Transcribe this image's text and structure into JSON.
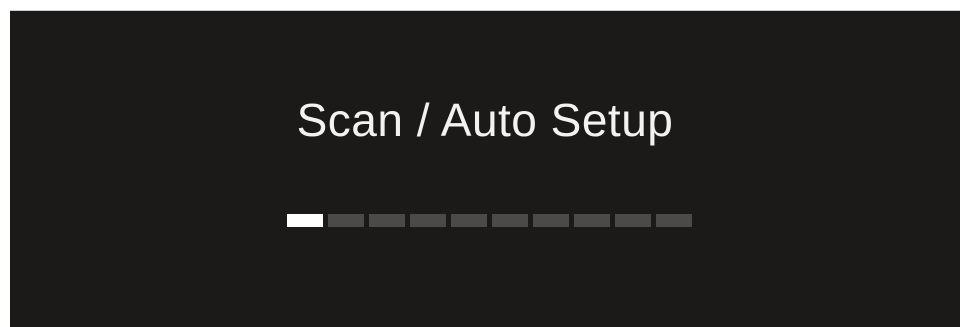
{
  "screen": {
    "title": "Scan / Auto Setup"
  },
  "progress": {
    "total_segments": 10,
    "filled_segments": 1,
    "fraction": 0.1,
    "active_color": "#ffffff",
    "inactive_color": "#4a4a4a"
  },
  "colors": {
    "background": "#1b1a19",
    "text": "#f2f2f2"
  }
}
